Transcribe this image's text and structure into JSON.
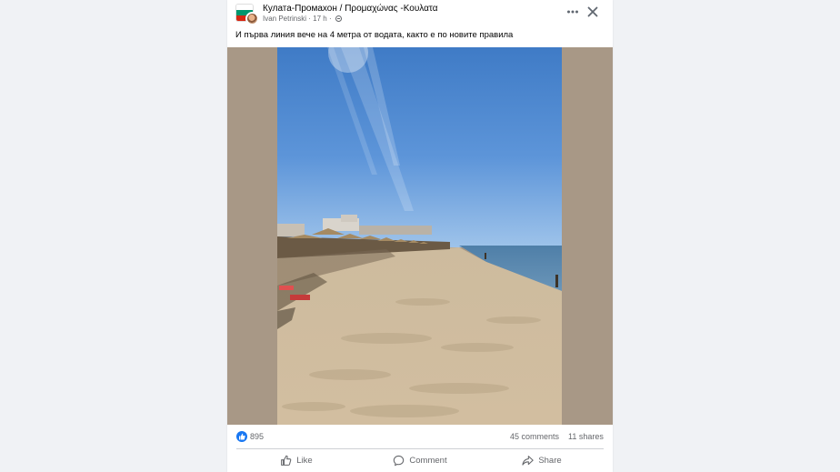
{
  "post": {
    "group_name": "Кулата-Промахон / Προμαχώνας -Κουλατα",
    "author": "Ivan Petrinski",
    "time": "17 h",
    "separator": "·",
    "caption": "И първа линия вече на 4 метра от водата, както е по новите правила",
    "photo_icon": "beach-photo",
    "more_icon": "more-dots-icon",
    "close_icon": "close-icon"
  },
  "stats": {
    "reaction_count": "895",
    "comments": "45 comments",
    "shares": "11 shares"
  },
  "actions": {
    "like_label": "Like",
    "comment_label": "Comment",
    "share_label": "Share"
  },
  "colors": {
    "accent": "#1877f2",
    "background": "#f0f2f5",
    "text_secondary": "#65676b",
    "photo_frame": "#a89886",
    "flag": [
      "#ffffff",
      "#00966e",
      "#d62612"
    ]
  }
}
